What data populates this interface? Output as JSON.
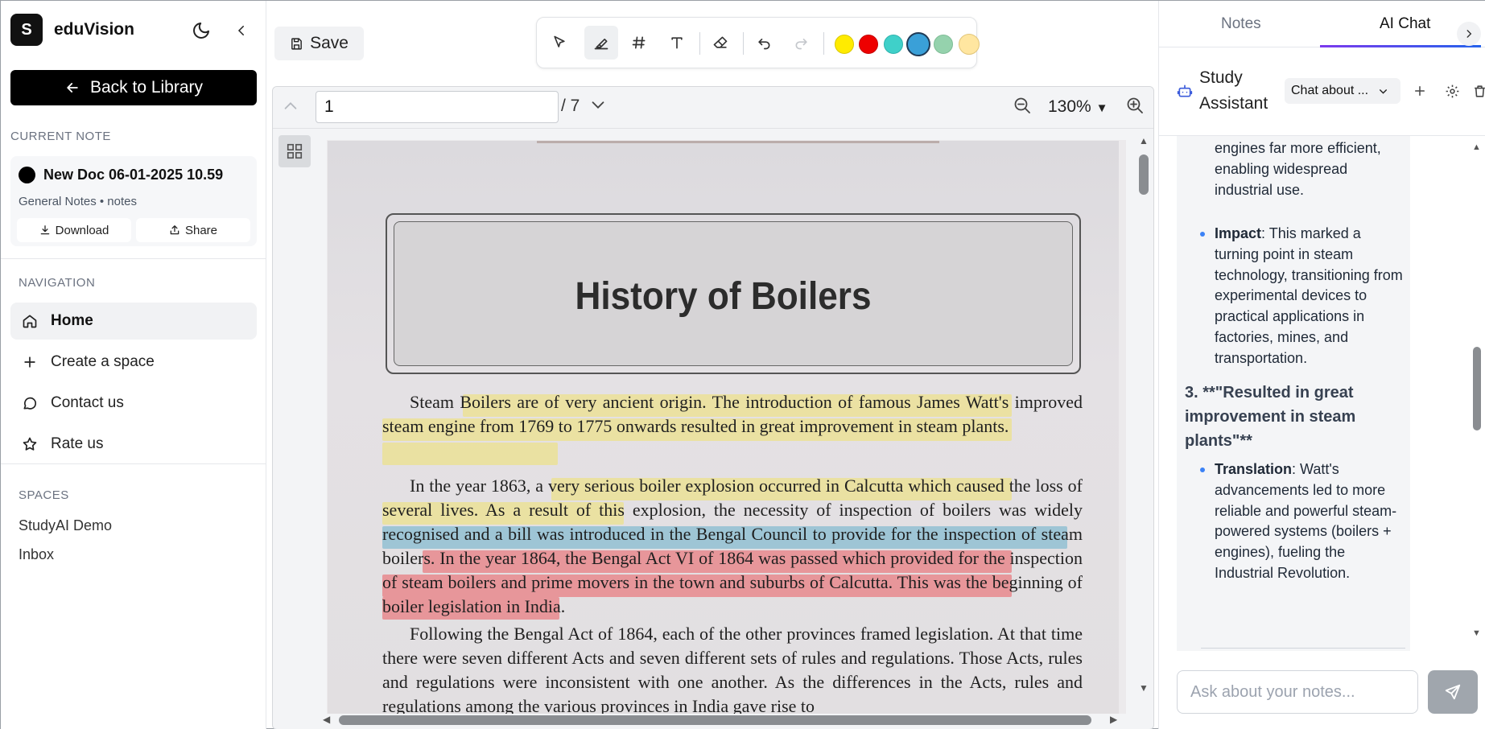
{
  "app": {
    "name": "eduVision",
    "logo_letter": "S"
  },
  "sidebar": {
    "back_label": "Back to Library",
    "current_note_title": "CURRENT NOTE",
    "note": {
      "title": "New Doc 06-01-2025 10.59",
      "meta": "General Notes • notes",
      "download_label": "Download",
      "share_label": "Share"
    },
    "navigation_title": "NAVIGATION",
    "nav": [
      {
        "label": "Home",
        "icon": "home-icon"
      },
      {
        "label": "Create a space",
        "icon": "plus-icon"
      },
      {
        "label": "Contact us",
        "icon": "chat-bubble-icon"
      },
      {
        "label": "Rate us",
        "icon": "star-icon"
      }
    ],
    "spaces_title": "SPACES",
    "spaces": [
      "StudyAI Demo",
      "Inbox"
    ]
  },
  "toolbar": {
    "save_label": "Save",
    "colors": [
      "#ffeb00",
      "#ee0000",
      "#3fd0c9",
      "#3aa0d8",
      "#95d2ad",
      "#ffe6a0"
    ],
    "selected_color": "#3aa0d8"
  },
  "viewer": {
    "page": "1",
    "page_total": "/ 7",
    "zoom": "130%",
    "document": {
      "title": "History of Boilers",
      "paragraphs": [
        "Steam Boilers are of very ancient origin. The introduction of famous James Watt's improved steam engine from 1769 to 1775 onwards resulted in great improvement in steam plants.",
        "In the year 1863, a very serious boiler explosion occurred in Calcutta which caused the loss of several lives. As a result of this explosion, the necessity of inspection of boilers was widely recognised and a bill was introduced in the Bengal Council to provide for the inspection of steam boilers. In the year 1864, the Bengal Act VI of 1864 was passed which provided for the inspection of steam boilers and prime movers in the town and suburbs of Calcutta. This was the beginning of boiler legislation in India.",
        "Following the Bengal Act of 1864, each of the other provinces framed legislation. At that time there were seven different Acts and seven different sets of rules and regulations. Those Acts, rules and regulations were inconsistent with one another. As the differences in the Acts, rules and regulations among the various provinces in India gave rise to"
      ]
    }
  },
  "right_panel": {
    "tabs": [
      "Notes",
      "AI Chat"
    ],
    "active_tab": "AI Chat",
    "assistant_title": "Study Assistant",
    "chat_select": "Chat about ...",
    "chat": {
      "bullet_top": "engines far more efficient, enabling widespread industrial use.",
      "impact_label": "Impact",
      "impact_text": ": This marked a turning point in steam technology, transitioning from experimental devices to practical applications in factories, mines, and transportation.",
      "heading": "3. **\"Resulted in great improvement in steam plants\"**",
      "translation_label": "Translation",
      "translation_text": ": Watt's advancements led to more reliable and powerful steam-powered systems (boilers + engines), fueling the Industrial Revolution."
    },
    "input_placeholder": "Ask about your notes..."
  }
}
